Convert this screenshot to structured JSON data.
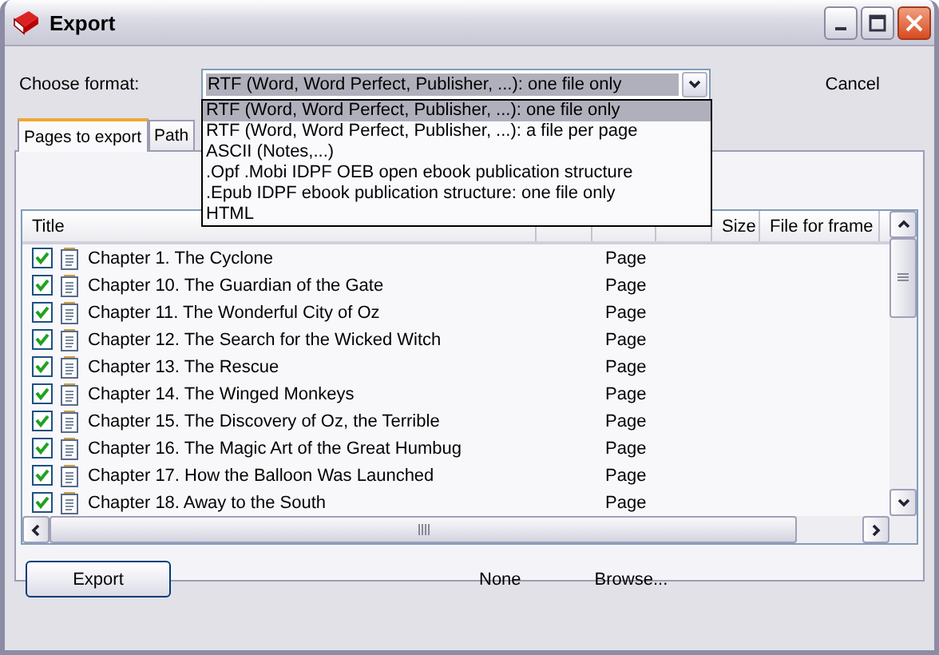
{
  "window": {
    "title": "Export"
  },
  "format": {
    "label": "Choose format:",
    "value": "RTF (Word, Word Perfect, Publisher, ...): one file only",
    "open": true,
    "options": [
      {
        "label": "RTF (Word, Word Perfect, Publisher, ...): one file only",
        "selected": true
      },
      {
        "label": "RTF (Word, Word Perfect, Publisher, ...): a file per page",
        "selected": false
      },
      {
        "label": "ASCII (Notes,...)",
        "selected": false
      },
      {
        "label": ".Opf .Mobi IDPF OEB open ebook publication structure",
        "selected": false
      },
      {
        "label": ".Epub IDPF ebook publication structure: one file only",
        "selected": false
      },
      {
        "label": "HTML",
        "selected": false
      }
    ]
  },
  "cancel_button": "Cancel",
  "tabs": [
    {
      "label": "Pages to export",
      "selected": true
    },
    {
      "label": "Path",
      "selected": false
    }
  ],
  "table": {
    "columns": [
      "Title",
      "Size",
      "File for frame"
    ],
    "rows": [
      {
        "checked": true,
        "title": "Chapter 1. The Cyclone",
        "type": "Page"
      },
      {
        "checked": true,
        "title": "Chapter 10. The Guardian of the Gate",
        "type": "Page"
      },
      {
        "checked": true,
        "title": "Chapter 11. The Wonderful City of Oz",
        "type": "Page"
      },
      {
        "checked": true,
        "title": "Chapter 12. The Search for the Wicked Witch",
        "type": "Page"
      },
      {
        "checked": true,
        "title": "Chapter 13. The Rescue",
        "type": "Page"
      },
      {
        "checked": true,
        "title": "Chapter 14. The Winged Monkeys",
        "type": "Page"
      },
      {
        "checked": true,
        "title": "Chapter 15. The Discovery of Oz, the Terrible",
        "type": "Page"
      },
      {
        "checked": true,
        "title": "Chapter 16. The Magic Art of the Great Humbug",
        "type": "Page"
      },
      {
        "checked": true,
        "title": "Chapter 17. How the Balloon Was Launched",
        "type": "Page"
      },
      {
        "checked": true,
        "title": "Chapter 18. Away to the South",
        "type": "Page"
      }
    ]
  },
  "footer": {
    "export_button": "Export",
    "path": "None",
    "browse": "Browse..."
  }
}
